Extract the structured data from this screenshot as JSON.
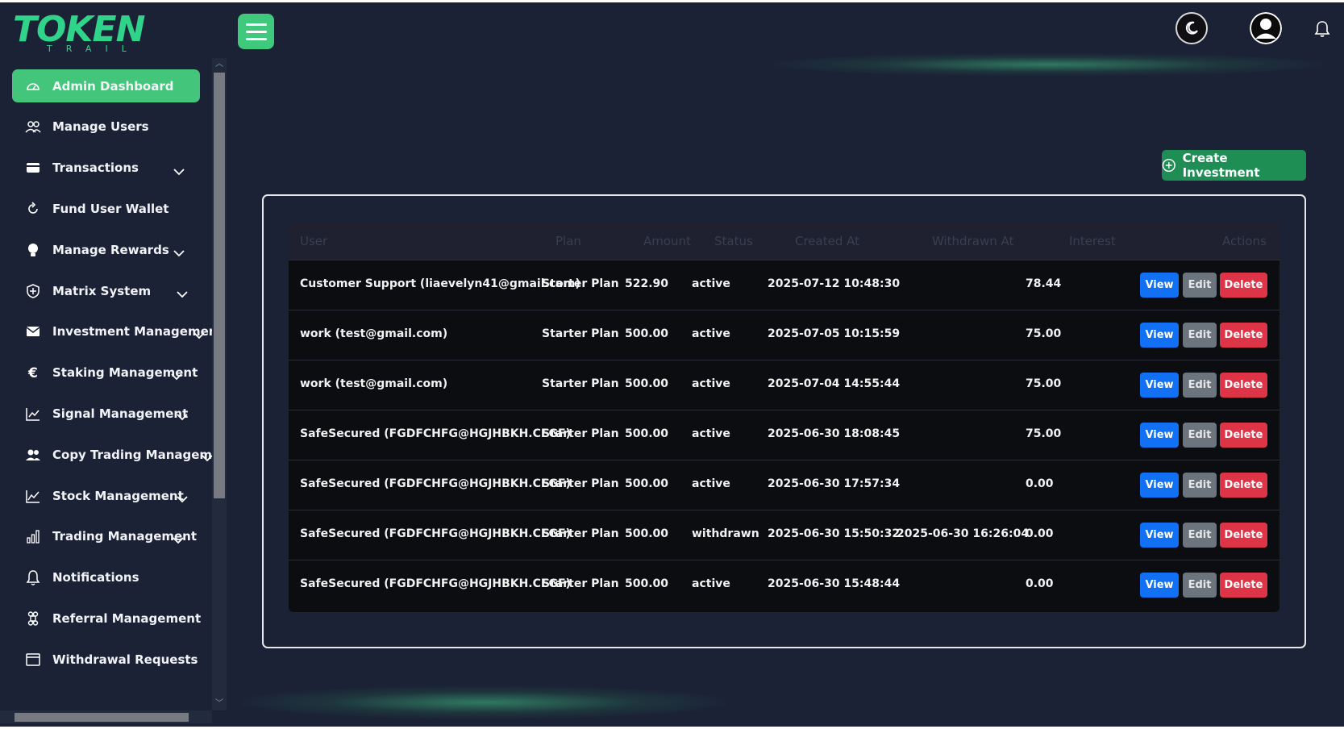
{
  "header": {
    "logo_main": "TOKEN",
    "logo_sub": "TRAIL",
    "icons": [
      "menu-icon",
      "moon-icon",
      "user-avatar-icon",
      "bell-icon"
    ]
  },
  "sidebar": {
    "items": [
      {
        "label": "Admin Dashboard",
        "icon": "dashboard-icon",
        "active": true
      },
      {
        "label": "Manage Users",
        "icon": "users-icon"
      },
      {
        "label": "Transactions",
        "icon": "card-icon",
        "dropdown": true
      },
      {
        "label": "Fund User Wallet",
        "icon": "refresh-icon"
      },
      {
        "label": "Manage Rewards",
        "icon": "lightbulb-icon",
        "dropdown": true
      },
      {
        "label": "Matrix System",
        "icon": "shield-icon",
        "dropdown": true
      },
      {
        "label": "Investment Management",
        "icon": "envelope-icon",
        "dropdown": true
      },
      {
        "label": "Staking Management",
        "icon": "euro-icon",
        "dropdown": true
      },
      {
        "label": "Signal Management",
        "icon": "trend-chart-icon",
        "dropdown": true
      },
      {
        "label": "Copy Trading Management",
        "icon": "people-icon",
        "dropdown": true
      },
      {
        "label": "Stock Management",
        "icon": "line-chart-icon",
        "dropdown": true
      },
      {
        "label": "Trading Management",
        "icon": "bar-chart-icon",
        "dropdown": true
      },
      {
        "label": "Notifications",
        "icon": "bell-icon"
      },
      {
        "label": "Referral Management",
        "icon": "command-icon"
      },
      {
        "label": "Withdrawal Requests",
        "icon": "window-icon"
      }
    ]
  },
  "main": {
    "create_button_label": "Create Investment",
    "table": {
      "headers": [
        "User",
        "Plan",
        "Amount",
        "Status",
        "Created At",
        "Withdrawn At",
        "Interest",
        "Actions"
      ],
      "rows": [
        {
          "user": "Customer Support (liaevelyn41@gmail.com)",
          "plan": "Starter Plan",
          "amount": "522.90",
          "status": "active",
          "created_at": "2025-07-12 10:48:30",
          "withdrawn_at": "",
          "interest": "78.44"
        },
        {
          "user": "work (test@gmail.com)",
          "plan": "Starter Plan",
          "amount": "500.00",
          "status": "active",
          "created_at": "2025-07-05 10:15:59",
          "withdrawn_at": "",
          "interest": "75.00"
        },
        {
          "user": "work (test@gmail.com)",
          "plan": "Starter Plan",
          "amount": "500.00",
          "status": "active",
          "created_at": "2025-07-04 14:55:44",
          "withdrawn_at": "",
          "interest": "75.00"
        },
        {
          "user": "SafeSecured (FGDFCHFG@HGJHBKH.CFGF)",
          "plan": "Starter Plan",
          "amount": "500.00",
          "status": "active",
          "created_at": "2025-06-30 18:08:45",
          "withdrawn_at": "",
          "interest": "75.00"
        },
        {
          "user": "SafeSecured (FGDFCHFG@HGJHBKH.CFGF)",
          "plan": "Starter Plan",
          "amount": "500.00",
          "status": "active",
          "created_at": "2025-06-30 17:57:34",
          "withdrawn_at": "",
          "interest": "0.00"
        },
        {
          "user": "SafeSecured (FGDFCHFG@HGJHBKH.CFGF)",
          "plan": "Starter Plan",
          "amount": "500.00",
          "status": "withdrawn",
          "created_at": "2025-06-30 15:50:32",
          "withdrawn_at": "2025-06-30 16:26:04",
          "interest": "0.00"
        },
        {
          "user": "SafeSecured (FGDFCHFG@HGJHBKH.CFGF)",
          "plan": "Starter Plan",
          "amount": "500.00",
          "status": "active",
          "created_at": "2025-06-30 15:48:44",
          "withdrawn_at": "",
          "interest": "0.00"
        }
      ],
      "action_labels": {
        "view": "View",
        "edit": "Edit",
        "delete": "Delete"
      }
    }
  },
  "colors": {
    "background": "#1b2236",
    "accent_green": "#44c57c",
    "create_green": "#1e8e55",
    "view_blue": "#1270f5",
    "edit_gray": "#6c747e",
    "delete_red": "#de3447"
  }
}
